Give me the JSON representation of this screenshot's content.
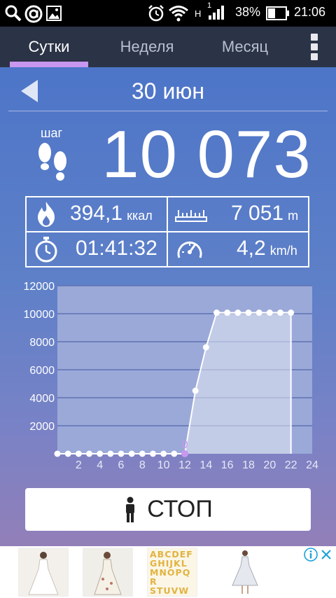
{
  "status_bar": {
    "network_label": "H",
    "sim_slot": "1",
    "battery_percent": "38%",
    "time": "21:06"
  },
  "tabs": [
    {
      "label": "Сутки",
      "active": true
    },
    {
      "label": "Неделя",
      "active": false
    },
    {
      "label": "Месяц",
      "active": false
    }
  ],
  "date": {
    "label": "30 июн"
  },
  "steps": {
    "label": "шаг",
    "value": "10 073"
  },
  "stats": {
    "calories": {
      "value": "394,1",
      "unit": "ккал"
    },
    "distance": {
      "value": "7 051",
      "unit": "m"
    },
    "duration": {
      "value": "01:41:32"
    },
    "speed": {
      "value": "4,2",
      "unit": "km/h"
    }
  },
  "chart_data": {
    "type": "area",
    "x": [
      0,
      1,
      2,
      3,
      4,
      5,
      6,
      7,
      8,
      9,
      10,
      11,
      12,
      13,
      14,
      15,
      16,
      17,
      18,
      19,
      20,
      21,
      22
    ],
    "values": [
      0,
      0,
      0,
      0,
      0,
      0,
      0,
      0,
      0,
      0,
      0,
      0,
      0,
      4500,
      7600,
      10073,
      10073,
      10073,
      10073,
      10073,
      10073,
      10073,
      10073
    ],
    "xticks": [
      "2",
      "4",
      "6",
      "8",
      "10",
      "12",
      "14",
      "16",
      "18",
      "20",
      "22",
      "24"
    ],
    "yticks": [
      "2000",
      "4000",
      "6000",
      "8000",
      "10000",
      "12000"
    ],
    "xlim": [
      0,
      24
    ],
    "ylim": [
      0,
      12000
    ],
    "grid": true,
    "marker_label": "0",
    "marker_x": 12,
    "colors": {
      "area": "#e6e9f4",
      "plot_bg": "#9aa9d8",
      "line": "#ffffff",
      "marker": "#c897f0",
      "grid": "#5f73b3"
    }
  },
  "stop_button": {
    "label": "СТОП"
  },
  "ad": {
    "thumbs": [
      "ABCDEF GHIJKL MNOPQR STUVW"
    ]
  },
  "colors": {
    "accent": "#c897f0",
    "tab_bar_bg": "#2b3346"
  }
}
